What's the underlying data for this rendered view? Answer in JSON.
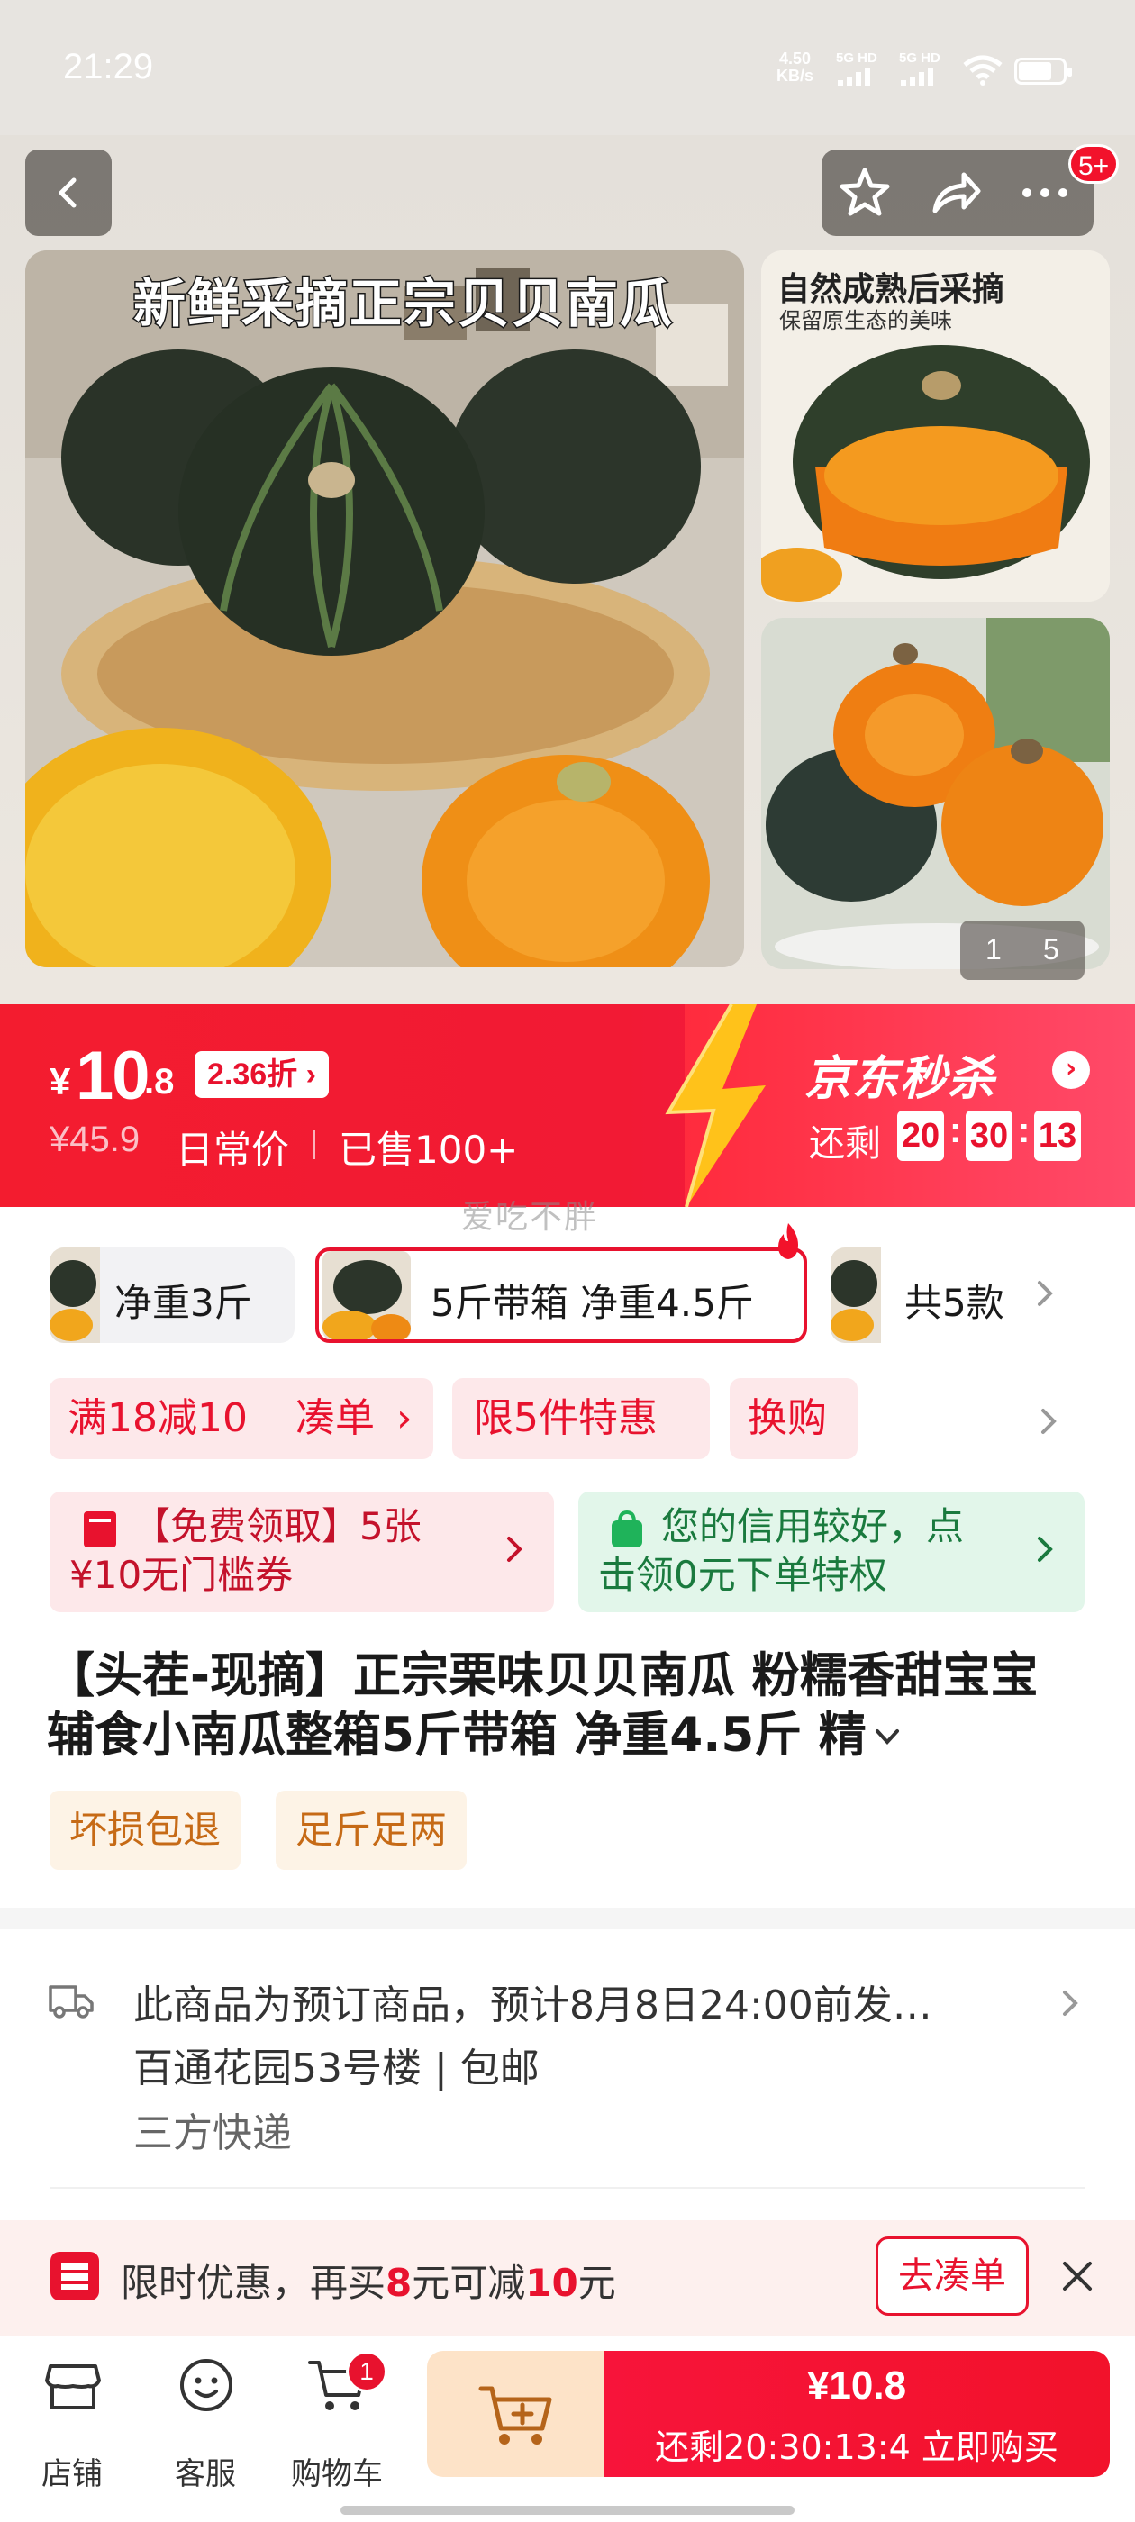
{
  "status_bar": {
    "time": "21:29",
    "net_speed_value": "4.50",
    "net_speed_unit": "KB/s",
    "sim1": "5G HD",
    "sim2": "5G HD"
  },
  "nav": {
    "more_badge": "5+"
  },
  "gallery": {
    "main_caption": "新鲜采摘正宗贝贝南瓜",
    "side1_title": "自然成熟后采摘",
    "side1_subtitle": "保留原生态的美味",
    "pager_current": "1",
    "pager_total": "5"
  },
  "price": {
    "currency": "¥",
    "integer": "10",
    "decimal": ".8",
    "discount": "2.36折",
    "original": "¥45.9",
    "daily_label": "日常价",
    "sold": "已售100+",
    "seckill_title": "京东秒杀",
    "remain_label": "还剩",
    "countdown_h": "20",
    "countdown_m": "30",
    "countdown_s": "13"
  },
  "watermark": "爱吃不胖",
  "variants": {
    "items": [
      {
        "label": "净重3斤"
      },
      {
        "label": "5斤带箱 净重4.5斤"
      },
      {
        "label": "共5款"
      }
    ],
    "selected_index": 1
  },
  "promos": [
    "满18减10",
    "凑单",
    "限5件特惠",
    "换购"
  ],
  "coupons": {
    "red_line1": "【免费领取】5张",
    "red_line2": "¥10无门槛券",
    "green_line1": "您的信用较好，点",
    "green_line2": "击领0元下单特权"
  },
  "product": {
    "title_line1": "【头茬-现摘】正宗栗味贝贝南瓜  粉糯香甜宝宝",
    "title_line2": "辅食小南瓜整箱5斤带箱 净重4.5斤 精",
    "tags": [
      "坏损包退",
      "足斤足两"
    ]
  },
  "shipping": {
    "line1": "此商品为预订商品，预计8月8日24:00前发…",
    "line2": "百通花园53号楼 | 包邮",
    "line3": "三方快递"
  },
  "promo_bar": {
    "text_a": "限时优惠，再买",
    "amount1": "8",
    "text_b": "元可减",
    "amount2": "10",
    "text_c": "元",
    "button": "去凑单"
  },
  "action_bar": {
    "store": "店铺",
    "service": "客服",
    "cart": "购物车",
    "cart_count": "1",
    "buy_price": "¥10.8",
    "buy_sub": "还剩20:30:13:4  立即购买"
  },
  "colors": {
    "brand_red": "#e8122e",
    "banner_red": "#f21a34",
    "coupon_green": "#1a7a3e",
    "tag_orange": "#c66a16"
  }
}
